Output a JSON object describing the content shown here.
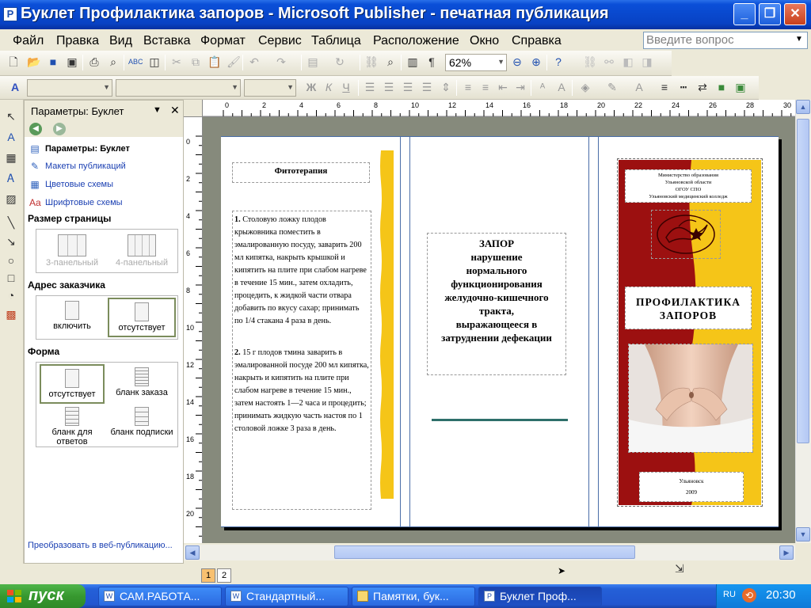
{
  "window": {
    "title": "Буклет Профилактика запоров - Microsoft Publisher - печатная публикация",
    "controls": [
      "_",
      "❐",
      "✕"
    ]
  },
  "menu": {
    "items": [
      "Файл",
      "Правка",
      "Вид",
      "Вставка",
      "Формат",
      "Сервис",
      "Таблица",
      "Расположение",
      "Окно",
      "Справка"
    ],
    "ask_placeholder": "Введите вопрос"
  },
  "toolbar": {
    "zoom": "62%"
  },
  "taskpane": {
    "title": "Параметры: Буклет",
    "links": [
      "Параметры: Буклет",
      "Макеты публикаций",
      "Цветовые схемы",
      "Шрифтовые схемы"
    ],
    "sections": {
      "page_size": {
        "label": "Размер страницы",
        "options": [
          "3-панельный",
          "4-панельный"
        ]
      },
      "customer_address": {
        "label": "Адрес заказчика",
        "options": [
          "включить",
          "отсутствует"
        ]
      },
      "form": {
        "label": "Форма",
        "options": [
          "отсутствует",
          "бланк заказа",
          "бланк для ответов",
          "бланк подписки"
        ]
      }
    },
    "footer_link": "Преобразовать в веб-публикацию..."
  },
  "rulers": {
    "horizontal": [
      "0",
      "2",
      "4",
      "6",
      "8",
      "10",
      "12",
      "14",
      "16",
      "18",
      "20",
      "22",
      "24",
      "26",
      "28",
      "30"
    ],
    "vertical": [
      "0",
      "2",
      "4",
      "6",
      "8",
      "10",
      "12",
      "14",
      "16",
      "18",
      "20"
    ]
  },
  "document": {
    "panel1": {
      "heading": "Фитотерапия",
      "recipe1_num": "1.",
      "recipe1": "Столовую ложку плодов крыжовника поместить в эмалированную посуду, заварить 200 мл кипятка, накрыть крышкой и кипятить на плите при слабом нагреве в течение 15 мин., затем охладить, процедить, к жидкой части отвара добавить по вкусу сахар; принимать по 1/4 стакана 4 раза в день.",
      "recipe2_num": "2.",
      "recipe2": "15 г плодов тмина заварить в эмалированной посуде 200 мл кипятка, накрыть и кипятить на плите при слабом нагреве в течение 15 мин., затем настоять 1—2 часа и процедить; принимать жидкую часть настоя по 1 столовой ложке 3 раза в день."
    },
    "panel2": {
      "definition": "ЗАПОР\nнарушение\nнормального\nфункционирования\nжелудочно-кишечного\nтракта,\nвыражающееся в\nзатруднении дефекации"
    },
    "panel3": {
      "org_line1": "Министерство образования",
      "org_line2": "Ульяновской области",
      "org_line3": "ОГОУ СПО",
      "org_line4": "Ульяновский медицинский колледж",
      "title": "ПРОФИЛАКТИКА\nЗАПОРОВ",
      "city": "Ульяновск",
      "year": "2009"
    }
  },
  "pages": [
    "1",
    "2"
  ],
  "taskbar": {
    "start": "пуск",
    "buttons": [
      "САМ.РАБОТА...",
      "Стандартный...",
      "Памятки, бук...",
      "Буклет Проф..."
    ],
    "lang": "RU",
    "clock": "20:30"
  },
  "colors": {
    "title_blue": "#0842c4",
    "dark_red": "#9c1010",
    "yellow": "#f5c518",
    "teal_rule": "#2e6f6a"
  }
}
